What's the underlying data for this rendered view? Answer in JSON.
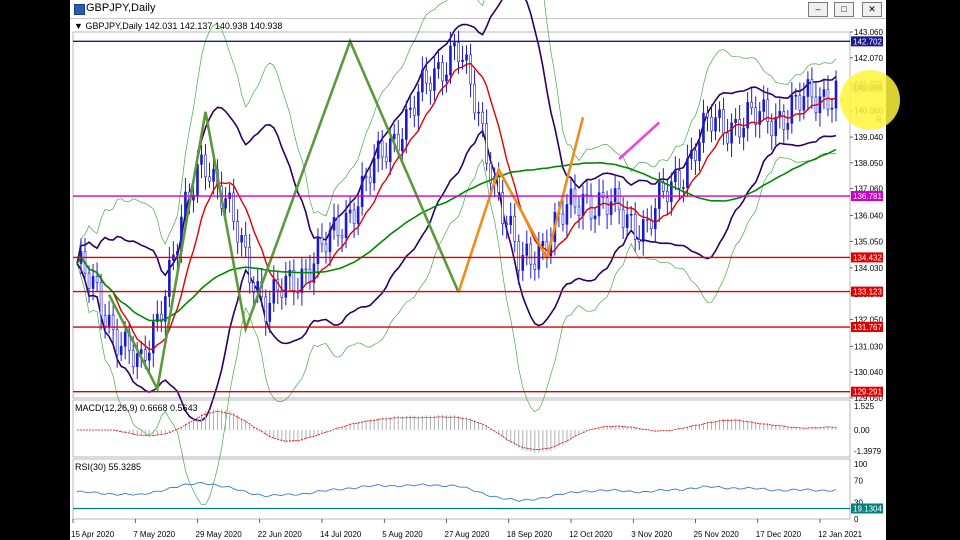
{
  "window": {
    "title": "GBPJPY,Daily",
    "buttons": [
      "–",
      "□",
      "✕"
    ]
  },
  "price_panel": {
    "header": "GBPJPY,Daily  142.031 142.137 140.938 140.938",
    "ohlc": {
      "open": 142.031,
      "high": 142.137,
      "low": 140.938,
      "close": 140.938
    },
    "price_axis_ticks": [
      "143.060",
      "142.070",
      "141.080",
      "140.060",
      "139.040",
      "138.050",
      "137.060",
      "136.040",
      "135.050",
      "134.030",
      "133.040",
      "132.050",
      "131.030",
      "130.040",
      "129.050"
    ],
    "ylim": [
      129.05,
      143.06
    ],
    "horizontal_levels": [
      {
        "price": 142.702,
        "label": "142.702",
        "color": "#1a1a8c"
      },
      {
        "price": 136.781,
        "label": "136.781",
        "color": "#cc00cc"
      },
      {
        "price": 134.432,
        "label": "134.432",
        "color": "#e00000"
      },
      {
        "price": 133.123,
        "label": "133.123",
        "color": "#e00000"
      },
      {
        "price": 131.767,
        "label": "131.767",
        "color": "#e00000"
      },
      {
        "price": 129.291,
        "label": "129.291",
        "color": "#e00000"
      }
    ],
    "current_price_label": "140.938",
    "partial_label": "R"
  },
  "date_axis": [
    "15 Apr 2020",
    "7 May 2020",
    "29 May 2020",
    "22 Jun 2020",
    "14 Jul 2020",
    "5 Aug 2020",
    "27 Aug 2020",
    "18 Sep 2020",
    "12 Oct 2020",
    "3 Nov 2020",
    "25 Nov 2020",
    "17 Dec 2020",
    "12 Jan 2021"
  ],
  "macd_panel": {
    "header": "MACD(12,26,9) 0.6668 0.5643",
    "ticks": [
      "1.525",
      "0.00",
      "-1.3979"
    ]
  },
  "rsi_panel": {
    "header": "RSI(30) 55.3285",
    "ticks": [
      "100",
      "70",
      "30",
      "0"
    ],
    "level_label": "19.1304"
  },
  "chart_data": {
    "type": "line",
    "symbol": "GBPJPY",
    "timeframe": "Daily",
    "x": [
      "15 Apr 2020",
      "7 May 2020",
      "29 May 2020",
      "22 Jun 2020",
      "14 Jul 2020",
      "5 Aug 2020",
      "27 Aug 2020",
      "18 Sep 2020",
      "12 Oct 2020",
      "3 Nov 2020",
      "25 Nov 2020",
      "17 Dec 2020",
      "12 Jan 2021"
    ],
    "series": [
      {
        "values": [
          134.2,
          130.0,
          138.5,
          132.5,
          135.0,
          139.0,
          142.7,
          134.0,
          136.8,
          135.6,
          139.5,
          139.8,
          140.9
        ]
      }
    ],
    "ylim": [
      129.05,
      143.06
    ],
    "grid": false,
    "colors": {
      "candles": "#1a1acc",
      "ma_fast": "#e00000",
      "ma_slow": "#008800",
      "bands": "#2a0060",
      "outer_bands": "#4aa84a"
    }
  },
  "colors": {
    "frame": "#000000",
    "window_bg": "#ffffff",
    "accent_green": "#5a9a3a",
    "accent_orange": "#f08c1a",
    "accent_magenta": "#ee44dd"
  }
}
